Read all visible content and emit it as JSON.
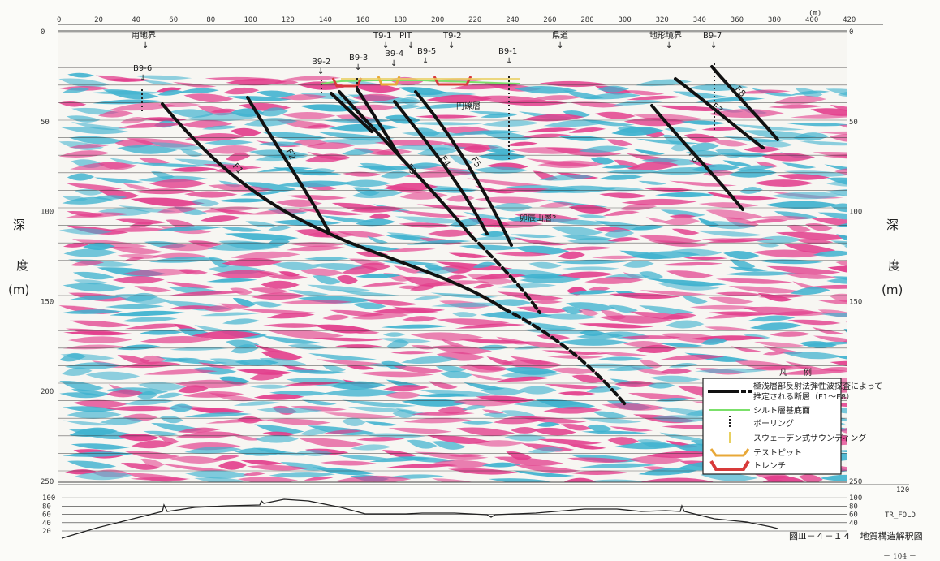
{
  "units_top": "(m)",
  "x_ticks": [
    "0",
    "20",
    "40",
    "60",
    "80",
    "100",
    "120",
    "140",
    "160",
    "180",
    "200",
    "220",
    "240",
    "260",
    "280",
    "300",
    "320",
    "340",
    "360",
    "380",
    "400",
    "420"
  ],
  "depth_ticks_left": [
    "0",
    "50",
    "100",
    "150",
    "200",
    "250"
  ],
  "depth_ticks_right": [
    "0",
    "50",
    "100",
    "150",
    "250"
  ],
  "axis_left": {
    "char1": "深",
    "char2": "度",
    "char3": "(m)"
  },
  "axis_right": {
    "char1": "深",
    "char2": "度",
    "char3": "(m)"
  },
  "surface_labels": [
    {
      "text": "用地界"
    },
    {
      "text": "T9-1"
    },
    {
      "text": "PIT"
    },
    {
      "text": "T9-2"
    },
    {
      "text": "県道"
    },
    {
      "text": "地形境界"
    },
    {
      "text": "B9-7"
    }
  ],
  "boring_labels": [
    "B9-6",
    "B9-2",
    "B9-3",
    "B9-4",
    "B9-5",
    "B9-1"
  ],
  "layer_labels": [
    "円礫層",
    "卯辰山層?"
  ],
  "faults": [
    "F1",
    "F2",
    "F3",
    "F4",
    "F5",
    "F6",
    "F7",
    "F8"
  ],
  "legend": {
    "title": "凡　　例",
    "items": [
      {
        "text": "極浅層部反射法弾性波探査によって",
        "text2": "推定される断層（F1～F8）",
        "color": "#111111"
      },
      {
        "text": "シルト層基底面",
        "color": "#7be06a"
      },
      {
        "text": "ボーリング",
        "color": "#222222"
      },
      {
        "text": "スウェーデン式サウンディング",
        "color": "#e8d060"
      },
      {
        "text": "テストピット",
        "color": "#e8a838"
      },
      {
        "text": "トレンチ",
        "color": "#d83a3a"
      }
    ]
  },
  "elev_ticks_left": [
    "100",
    "80",
    "60",
    "40",
    "20"
  ],
  "elev_ticks_right": [
    "120",
    "100",
    "80",
    "60",
    "40"
  ],
  "elev_label": "TR_FOLD",
  "caption": "図Ⅲ－４－１４　地質構造解釈図",
  "page_number": "－ 104 －",
  "colors": {
    "magenta": "#e23e8c",
    "cyan": "#3fb2cf",
    "fault": "#111111"
  }
}
